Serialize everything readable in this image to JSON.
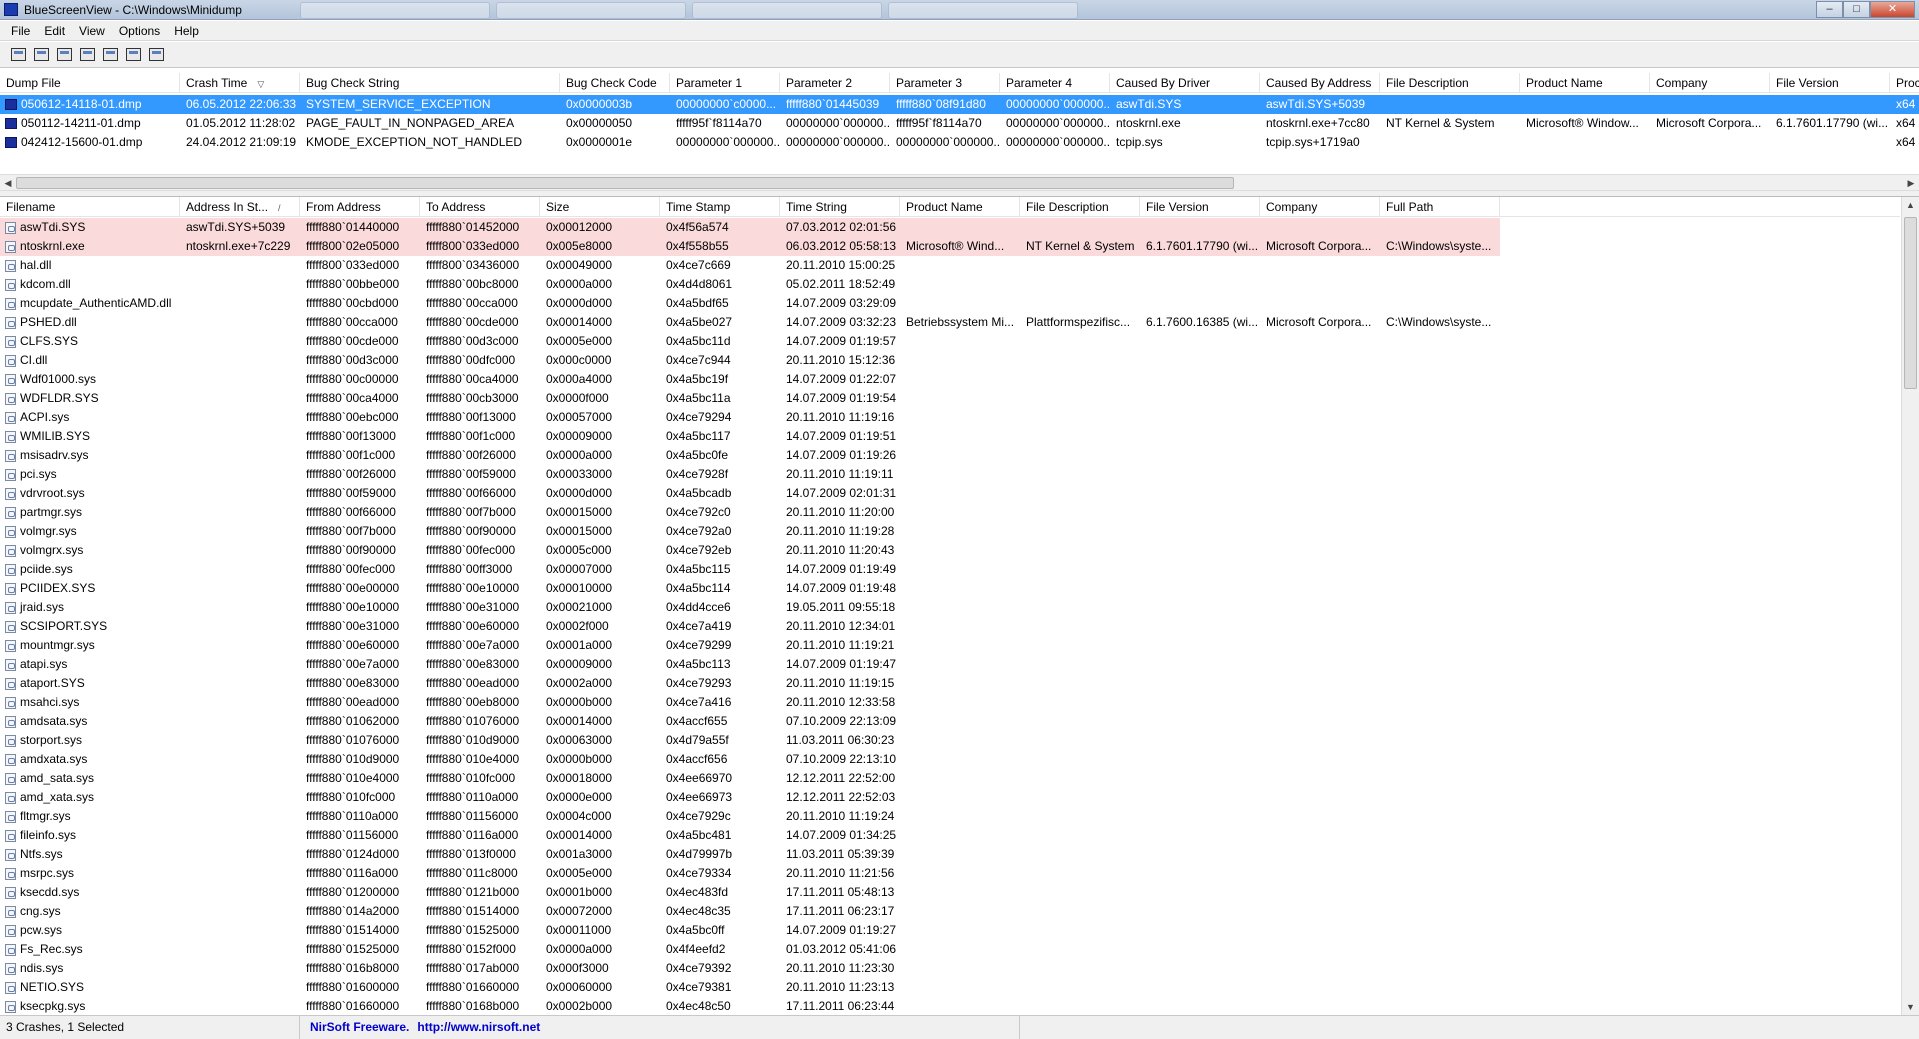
{
  "window": {
    "title": "BlueScreenView  -  C:\\Windows\\Minidump",
    "buttons": {
      "minimize": "–",
      "maximize": "□",
      "close": "✕"
    }
  },
  "menu": [
    "File",
    "Edit",
    "View",
    "Options",
    "Help"
  ],
  "toolbar": [
    "properties-icon",
    "save-icon",
    "refresh-icon",
    "copy-icon",
    "html-report-icon",
    "find-icon",
    "exit-icon"
  ],
  "upper": {
    "columns": [
      {
        "label": "Dump File",
        "sort": ""
      },
      {
        "label": "Crash Time",
        "sort": "▽"
      },
      {
        "label": "Bug Check String",
        "sort": ""
      },
      {
        "label": "Bug Check Code",
        "sort": ""
      },
      {
        "label": "Parameter 1",
        "sort": ""
      },
      {
        "label": "Parameter 2",
        "sort": ""
      },
      {
        "label": "Parameter 3",
        "sort": ""
      },
      {
        "label": "Parameter 4",
        "sort": ""
      },
      {
        "label": "Caused By Driver",
        "sort": ""
      },
      {
        "label": "Caused By Address",
        "sort": ""
      },
      {
        "label": "File Description",
        "sort": ""
      },
      {
        "label": "Product Name",
        "sort": ""
      },
      {
        "label": "Company",
        "sort": ""
      },
      {
        "label": "File Version",
        "sort": ""
      },
      {
        "label": "Proc",
        "sort": ""
      }
    ],
    "rows": [
      {
        "selected": true,
        "cells": [
          "050612-14118-01.dmp",
          "06.05.2012 22:06:33",
          "SYSTEM_SERVICE_EXCEPTION",
          "0x0000003b",
          "00000000`c0000...",
          "fffff880`01445039",
          "fffff880`08f91d80",
          "00000000`000000...",
          "aswTdi.SYS",
          "aswTdi.SYS+5039",
          "",
          "",
          "",
          "",
          "x64"
        ]
      },
      {
        "selected": false,
        "cells": [
          "050112-14211-01.dmp",
          "01.05.2012 11:28:02",
          "PAGE_FAULT_IN_NONPAGED_AREA",
          "0x00000050",
          "fffff95f`f8114a70",
          "00000000`000000...",
          "fffff95f`f8114a70",
          "00000000`000000...",
          "ntoskrnl.exe",
          "ntoskrnl.exe+7cc80",
          "NT Kernel & System",
          "Microsoft® Window...",
          "Microsoft Corpora...",
          "6.1.7601.17790 (wi...",
          "x64"
        ]
      },
      {
        "selected": false,
        "cells": [
          "042412-15600-01.dmp",
          "24.04.2012 21:09:19",
          "KMODE_EXCEPTION_NOT_HANDLED",
          "0x0000001e",
          "00000000`000000...",
          "00000000`000000...",
          "00000000`000000...",
          "00000000`000000...",
          "tcpip.sys",
          "tcpip.sys+1719a0",
          "",
          "",
          "",
          "",
          "x64"
        ]
      }
    ]
  },
  "lower": {
    "columns": [
      {
        "label": "Filename",
        "sort": ""
      },
      {
        "label": "Address In St...",
        "sort": "/"
      },
      {
        "label": "From Address",
        "sort": ""
      },
      {
        "label": "To Address",
        "sort": ""
      },
      {
        "label": "Size",
        "sort": ""
      },
      {
        "label": "Time Stamp",
        "sort": ""
      },
      {
        "label": "Time String",
        "sort": ""
      },
      {
        "label": "Product Name",
        "sort": ""
      },
      {
        "label": "File Description",
        "sort": ""
      },
      {
        "label": "File Version",
        "sort": ""
      },
      {
        "label": "Company",
        "sort": ""
      },
      {
        "label": "Full Path",
        "sort": ""
      }
    ],
    "rows": [
      {
        "hl": true,
        "cells": [
          "aswTdi.SYS",
          "aswTdi.SYS+5039",
          "fffff880`01440000",
          "fffff880`01452000",
          "0x00012000",
          "0x4f56a574",
          "07.03.2012 02:01:56",
          "",
          "",
          "",
          "",
          ""
        ]
      },
      {
        "hl": true,
        "cells": [
          "ntoskrnl.exe",
          "ntoskrnl.exe+7c229",
          "fffff800`02e05000",
          "fffff800`033ed000",
          "0x005e8000",
          "0x4f558b55",
          "06.03.2012 05:58:13",
          "Microsoft® Wind...",
          "NT Kernel & System",
          "6.1.7601.17790 (wi...",
          "Microsoft Corpora...",
          "C:\\Windows\\syste..."
        ]
      },
      {
        "hl": false,
        "cells": [
          "hal.dll",
          "",
          "fffff800`033ed000",
          "fffff800`03436000",
          "0x00049000",
          "0x4ce7c669",
          "20.11.2010 15:00:25",
          "",
          "",
          "",
          "",
          ""
        ]
      },
      {
        "hl": false,
        "cells": [
          "kdcom.dll",
          "",
          "fffff880`00bbe000",
          "fffff880`00bc8000",
          "0x0000a000",
          "0x4d4d8061",
          "05.02.2011 18:52:49",
          "",
          "",
          "",
          "",
          ""
        ]
      },
      {
        "hl": false,
        "cells": [
          "mcupdate_AuthenticAMD.dll",
          "",
          "fffff880`00cbd000",
          "fffff880`00cca000",
          "0x0000d000",
          "0x4a5bdf65",
          "14.07.2009 03:29:09",
          "",
          "",
          "",
          "",
          ""
        ]
      },
      {
        "hl": false,
        "cells": [
          "PSHED.dll",
          "",
          "fffff880`00cca000",
          "fffff880`00cde000",
          "0x00014000",
          "0x4a5be027",
          "14.07.2009 03:32:23",
          "Betriebssystem Mi...",
          "Plattformspezifisc...",
          "6.1.7600.16385 (wi...",
          "Microsoft Corpora...",
          "C:\\Windows\\syste..."
        ]
      },
      {
        "hl": false,
        "cells": [
          "CLFS.SYS",
          "",
          "fffff880`00cde000",
          "fffff880`00d3c000",
          "0x0005e000",
          "0x4a5bc11d",
          "14.07.2009 01:19:57",
          "",
          "",
          "",
          "",
          ""
        ]
      },
      {
        "hl": false,
        "cells": [
          "CI.dll",
          "",
          "fffff880`00d3c000",
          "fffff880`00dfc000",
          "0x000c0000",
          "0x4ce7c944",
          "20.11.2010 15:12:36",
          "",
          "",
          "",
          "",
          ""
        ]
      },
      {
        "hl": false,
        "cells": [
          "Wdf01000.sys",
          "",
          "fffff880`00c00000",
          "fffff880`00ca4000",
          "0x000a4000",
          "0x4a5bc19f",
          "14.07.2009 01:22:07",
          "",
          "",
          "",
          "",
          ""
        ]
      },
      {
        "hl": false,
        "cells": [
          "WDFLDR.SYS",
          "",
          "fffff880`00ca4000",
          "fffff880`00cb3000",
          "0x0000f000",
          "0x4a5bc11a",
          "14.07.2009 01:19:54",
          "",
          "",
          "",
          "",
          ""
        ]
      },
      {
        "hl": false,
        "cells": [
          "ACPI.sys",
          "",
          "fffff880`00ebc000",
          "fffff880`00f13000",
          "0x00057000",
          "0x4ce79294",
          "20.11.2010 11:19:16",
          "",
          "",
          "",
          "",
          ""
        ]
      },
      {
        "hl": false,
        "cells": [
          "WMILIB.SYS",
          "",
          "fffff880`00f13000",
          "fffff880`00f1c000",
          "0x00009000",
          "0x4a5bc117",
          "14.07.2009 01:19:51",
          "",
          "",
          "",
          "",
          ""
        ]
      },
      {
        "hl": false,
        "cells": [
          "msisadrv.sys",
          "",
          "fffff880`00f1c000",
          "fffff880`00f26000",
          "0x0000a000",
          "0x4a5bc0fe",
          "14.07.2009 01:19:26",
          "",
          "",
          "",
          "",
          ""
        ]
      },
      {
        "hl": false,
        "cells": [
          "pci.sys",
          "",
          "fffff880`00f26000",
          "fffff880`00f59000",
          "0x00033000",
          "0x4ce7928f",
          "20.11.2010 11:19:11",
          "",
          "",
          "",
          "",
          ""
        ]
      },
      {
        "hl": false,
        "cells": [
          "vdrvroot.sys",
          "",
          "fffff880`00f59000",
          "fffff880`00f66000",
          "0x0000d000",
          "0x4a5bcadb",
          "14.07.2009 02:01:31",
          "",
          "",
          "",
          "",
          ""
        ]
      },
      {
        "hl": false,
        "cells": [
          "partmgr.sys",
          "",
          "fffff880`00f66000",
          "fffff880`00f7b000",
          "0x00015000",
          "0x4ce792c0",
          "20.11.2010 11:20:00",
          "",
          "",
          "",
          "",
          ""
        ]
      },
      {
        "hl": false,
        "cells": [
          "volmgr.sys",
          "",
          "fffff880`00f7b000",
          "fffff880`00f90000",
          "0x00015000",
          "0x4ce792a0",
          "20.11.2010 11:19:28",
          "",
          "",
          "",
          "",
          ""
        ]
      },
      {
        "hl": false,
        "cells": [
          "volmgrx.sys",
          "",
          "fffff880`00f90000",
          "fffff880`00fec000",
          "0x0005c000",
          "0x4ce792eb",
          "20.11.2010 11:20:43",
          "",
          "",
          "",
          "",
          ""
        ]
      },
      {
        "hl": false,
        "cells": [
          "pciide.sys",
          "",
          "fffff880`00fec000",
          "fffff880`00ff3000",
          "0x00007000",
          "0x4a5bc115",
          "14.07.2009 01:19:49",
          "",
          "",
          "",
          "",
          ""
        ]
      },
      {
        "hl": false,
        "cells": [
          "PCIIDEX.SYS",
          "",
          "fffff880`00e00000",
          "fffff880`00e10000",
          "0x00010000",
          "0x4a5bc114",
          "14.07.2009 01:19:48",
          "",
          "",
          "",
          "",
          ""
        ]
      },
      {
        "hl": false,
        "cells": [
          "jraid.sys",
          "",
          "fffff880`00e10000",
          "fffff880`00e31000",
          "0x00021000",
          "0x4dd4cce6",
          "19.05.2011 09:55:18",
          "",
          "",
          "",
          "",
          ""
        ]
      },
      {
        "hl": false,
        "cells": [
          "SCSIPORT.SYS",
          "",
          "fffff880`00e31000",
          "fffff880`00e60000",
          "0x0002f000",
          "0x4ce7a419",
          "20.11.2010 12:34:01",
          "",
          "",
          "",
          "",
          ""
        ]
      },
      {
        "hl": false,
        "cells": [
          "mountmgr.sys",
          "",
          "fffff880`00e60000",
          "fffff880`00e7a000",
          "0x0001a000",
          "0x4ce79299",
          "20.11.2010 11:19:21",
          "",
          "",
          "",
          "",
          ""
        ]
      },
      {
        "hl": false,
        "cells": [
          "atapi.sys",
          "",
          "fffff880`00e7a000",
          "fffff880`00e83000",
          "0x00009000",
          "0x4a5bc113",
          "14.07.2009 01:19:47",
          "",
          "",
          "",
          "",
          ""
        ]
      },
      {
        "hl": false,
        "cells": [
          "ataport.SYS",
          "",
          "fffff880`00e83000",
          "fffff880`00ead000",
          "0x0002a000",
          "0x4ce79293",
          "20.11.2010 11:19:15",
          "",
          "",
          "",
          "",
          ""
        ]
      },
      {
        "hl": false,
        "cells": [
          "msahci.sys",
          "",
          "fffff880`00ead000",
          "fffff880`00eb8000",
          "0x0000b000",
          "0x4ce7a416",
          "20.11.2010 12:33:58",
          "",
          "",
          "",
          "",
          ""
        ]
      },
      {
        "hl": false,
        "cells": [
          "amdsata.sys",
          "",
          "fffff880`01062000",
          "fffff880`01076000",
          "0x00014000",
          "0x4accf655",
          "07.10.2009 22:13:09",
          "",
          "",
          "",
          "",
          ""
        ]
      },
      {
        "hl": false,
        "cells": [
          "storport.sys",
          "",
          "fffff880`01076000",
          "fffff880`010d9000",
          "0x00063000",
          "0x4d79a55f",
          "11.03.2011 06:30:23",
          "",
          "",
          "",
          "",
          ""
        ]
      },
      {
        "hl": false,
        "cells": [
          "amdxata.sys",
          "",
          "fffff880`010d9000",
          "fffff880`010e4000",
          "0x0000b000",
          "0x4accf656",
          "07.10.2009 22:13:10",
          "",
          "",
          "",
          "",
          ""
        ]
      },
      {
        "hl": false,
        "cells": [
          "amd_sata.sys",
          "",
          "fffff880`010e4000",
          "fffff880`010fc000",
          "0x00018000",
          "0x4ee66970",
          "12.12.2011 22:52:00",
          "",
          "",
          "",
          "",
          ""
        ]
      },
      {
        "hl": false,
        "cells": [
          "amd_xata.sys",
          "",
          "fffff880`010fc000",
          "fffff880`0110a000",
          "0x0000e000",
          "0x4ee66973",
          "12.12.2011 22:52:03",
          "",
          "",
          "",
          "",
          ""
        ]
      },
      {
        "hl": false,
        "cells": [
          "fltmgr.sys",
          "",
          "fffff880`0110a000",
          "fffff880`01156000",
          "0x0004c000",
          "0x4ce7929c",
          "20.11.2010 11:19:24",
          "",
          "",
          "",
          "",
          ""
        ]
      },
      {
        "hl": false,
        "cells": [
          "fileinfo.sys",
          "",
          "fffff880`01156000",
          "fffff880`0116a000",
          "0x00014000",
          "0x4a5bc481",
          "14.07.2009 01:34:25",
          "",
          "",
          "",
          "",
          ""
        ]
      },
      {
        "hl": false,
        "cells": [
          "Ntfs.sys",
          "",
          "fffff880`0124d000",
          "fffff880`013f0000",
          "0x001a3000",
          "0x4d79997b",
          "11.03.2011 05:39:39",
          "",
          "",
          "",
          "",
          ""
        ]
      },
      {
        "hl": false,
        "cells": [
          "msrpc.sys",
          "",
          "fffff880`0116a000",
          "fffff880`011c8000",
          "0x0005e000",
          "0x4ce79334",
          "20.11.2010 11:21:56",
          "",
          "",
          "",
          "",
          ""
        ]
      },
      {
        "hl": false,
        "cells": [
          "ksecdd.sys",
          "",
          "fffff880`01200000",
          "fffff880`0121b000",
          "0x0001b000",
          "0x4ec483fd",
          "17.11.2011 05:48:13",
          "",
          "",
          "",
          "",
          ""
        ]
      },
      {
        "hl": false,
        "cells": [
          "cng.sys",
          "",
          "fffff880`014a2000",
          "fffff880`01514000",
          "0x00072000",
          "0x4ec48c35",
          "17.11.2011 06:23:17",
          "",
          "",
          "",
          "",
          ""
        ]
      },
      {
        "hl": false,
        "cells": [
          "pcw.sys",
          "",
          "fffff880`01514000",
          "fffff880`01525000",
          "0x00011000",
          "0x4a5bc0ff",
          "14.07.2009 01:19:27",
          "",
          "",
          "",
          "",
          ""
        ]
      },
      {
        "hl": false,
        "cells": [
          "Fs_Rec.sys",
          "",
          "fffff880`01525000",
          "fffff880`0152f000",
          "0x0000a000",
          "0x4f4eefd2",
          "01.03.2012 05:41:06",
          "",
          "",
          "",
          "",
          ""
        ]
      },
      {
        "hl": false,
        "cells": [
          "ndis.sys",
          "",
          "fffff880`016b8000",
          "fffff880`017ab000",
          "0x000f3000",
          "0x4ce79392",
          "20.11.2010 11:23:30",
          "",
          "",
          "",
          "",
          ""
        ]
      },
      {
        "hl": false,
        "cells": [
          "NETIO.SYS",
          "",
          "fffff880`01600000",
          "fffff880`01660000",
          "0x00060000",
          "0x4ce79381",
          "20.11.2010 11:23:13",
          "",
          "",
          "",
          "",
          ""
        ]
      },
      {
        "hl": false,
        "cells": [
          "ksecpkg.sys",
          "",
          "fffff880`01660000",
          "fffff880`0168b000",
          "0x0002b000",
          "0x4ec48c50",
          "17.11.2011 06:23:44",
          "",
          "",
          "",
          "",
          ""
        ]
      }
    ]
  },
  "status": {
    "count": "3 Crashes, 1 Selected",
    "nirsoft": "NirSoft Freeware.",
    "url": "http://www.nirsoft.net"
  }
}
